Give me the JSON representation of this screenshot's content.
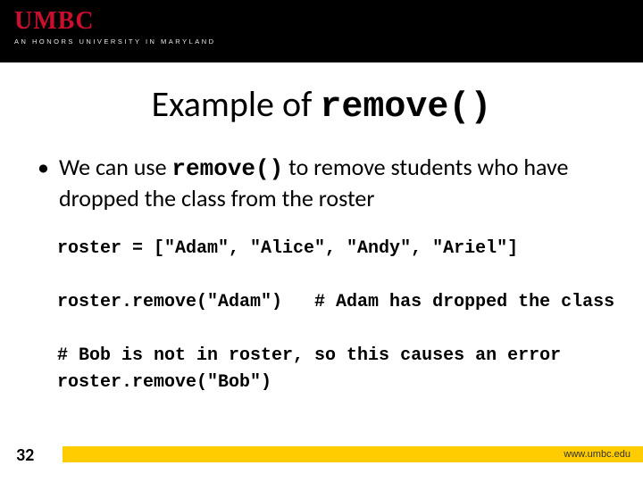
{
  "header": {
    "logo_text": "UMBC",
    "tagline": "AN HONORS UNIVERSITY IN MARYLAND"
  },
  "title": {
    "prefix": "Example of ",
    "code": "remove()"
  },
  "bullet": {
    "dot": "•",
    "part1": "We can use ",
    "code": "remove()",
    "part2": " to remove students who have dropped the class from the roster"
  },
  "code": {
    "line1": "roster = [\"Adam\", \"Alice\", \"Andy\", \"Ariel\"]",
    "blank1": "",
    "line2": "roster.remove(\"Adam\")   # Adam has dropped the class",
    "blank2": "",
    "line3": "# Bob is not in roster, so this causes an error",
    "line4": "roster.remove(\"Bob\")"
  },
  "footer": {
    "slide_number": "32",
    "url": "www.umbc.edu"
  }
}
